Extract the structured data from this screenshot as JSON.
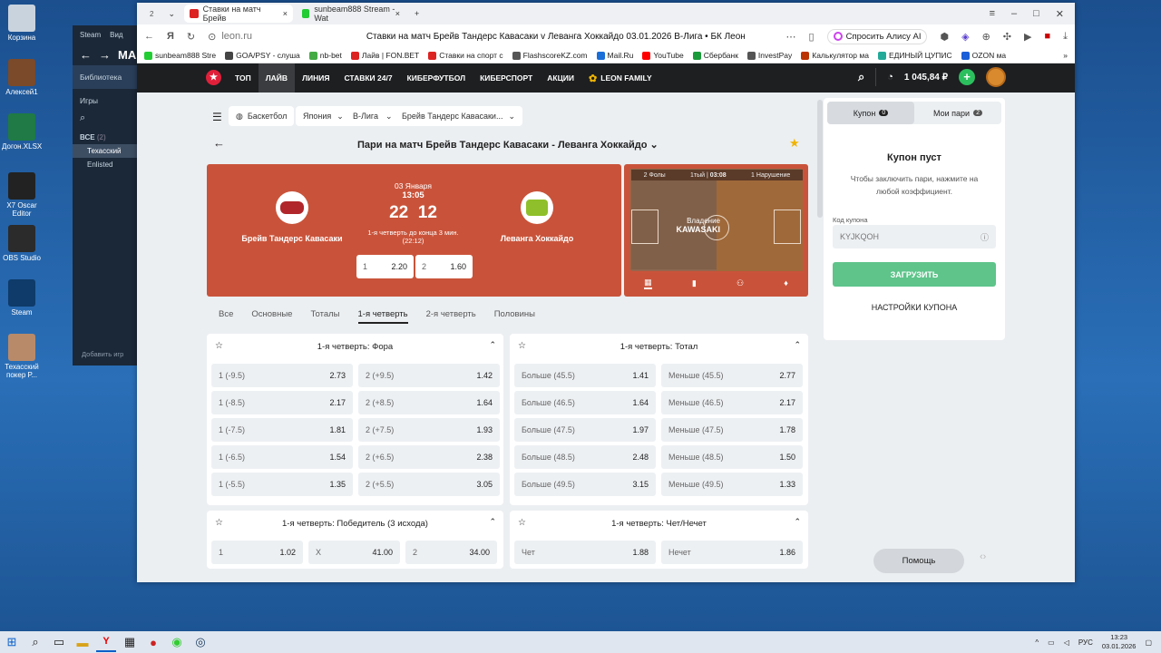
{
  "desktop": {
    "icons": [
      {
        "label": "Корзина",
        "color": "#c9d3de"
      },
      {
        "label": "Алексей1",
        "color": "#7a4a2a"
      },
      {
        "label": "Догон.XLSX",
        "color": "#1f7a45"
      },
      {
        "label": "X7 Oscar Editor",
        "color": "#222"
      },
      {
        "label": "OBS Studio",
        "color": "#2b2b2b"
      },
      {
        "label": "Steam",
        "color": "#0e3b6a"
      },
      {
        "label": "Техасский покер Р...",
        "color": "#b88a6a"
      }
    ]
  },
  "steam": {
    "top": [
      "Steam",
      "Вид"
    ],
    "title": "МАГ",
    "library": "Библиотека",
    "games": "Игры",
    "all": "ВСЕ",
    "all_count": "(2)",
    "items": [
      "Техасский",
      "Enlisted"
    ],
    "add": "Добавить игр"
  },
  "browser": {
    "tabs": [
      {
        "label": "Ставки на матч Брейв",
        "color": "#d22"
      },
      {
        "label": "sunbeam888 Stream - Wat",
        "color": "#2c3"
      }
    ],
    "tab_count": "2",
    "url": "leon.ru",
    "page_title": "Ставки на матч Брейв Тандерс Кавасаки v Леванга Хоккайдо 03.01.2026 В-Лига • БК Леон",
    "alice": "Спросить Алису AI",
    "bookmarks": [
      {
        "label": "sunbeam888 Stre",
        "color": "#2c3"
      },
      {
        "label": "GOA/PSY - слуша",
        "color": "#444"
      },
      {
        "label": "nb-bet",
        "color": "#4a4"
      },
      {
        "label": "Лайв | FON.BET",
        "color": "#d22"
      },
      {
        "label": "Ставки на спорт с",
        "color": "#d22"
      },
      {
        "label": "FlashscoreKZ.com",
        "color": "#555"
      },
      {
        "label": "Mail.Ru",
        "color": "#1a6ed8"
      },
      {
        "label": "YouTube",
        "color": "#f00"
      },
      {
        "label": "Сбербанк",
        "color": "#1a9a3a"
      },
      {
        "label": "InvestPay",
        "color": "#555"
      },
      {
        "label": "Калькулятор ма",
        "color": "#b30"
      },
      {
        "label": "ЕДИНЫЙ ЦУПИС",
        "color": "#2a9"
      },
      {
        "label": "OZON ма",
        "color": "#1a5ed8"
      }
    ]
  },
  "leon": {
    "nav": [
      "ТОП",
      "ЛАЙВ",
      "ЛИНИЯ",
      "СТАВКИ 24/7",
      "КИБЕРФУТБОЛ",
      "КИБЕРСПОРТ",
      "АКЦИИ",
      "LEON FAMILY"
    ],
    "balance": "1 045,84 ₽",
    "breadcrumbs": [
      "Баскетбол",
      "Япония",
      "В-Лига",
      "Брейв Тандерс Кавасаки..."
    ],
    "event_title": "Пари на матч Брейв Тандерс Кавасаки - Леванга Хоккайдо",
    "match": {
      "date": "03 Января",
      "time": "13:05",
      "home": "Брейв Тандерс Кавасаки",
      "away": "Леванга Хоккайдо",
      "score_home": "22",
      "score_away": "12",
      "period": "1-я четверть до конца 3 мин.",
      "period_score": "(22:12)",
      "odd1_label": "1",
      "odd1": "2.20",
      "odd2_label": "2",
      "odd2": "1.60"
    },
    "court": {
      "fouls": "2 Фолы",
      "period": "1тый",
      "clock": "03:08",
      "violations": "1 Нарушение",
      "possession_label": "Владение",
      "possession_team": "KAWASAKI"
    },
    "market_tabs": [
      "Все",
      "Основные",
      "Тоталы",
      "1-я четверть",
      "2-я четверть",
      "Половины"
    ],
    "markets": [
      {
        "title": "1-я четверть: Фора",
        "rows": [
          [
            "1 (-9.5)",
            "2.73",
            "2 (+9.5)",
            "1.42"
          ],
          [
            "1 (-8.5)",
            "2.17",
            "2 (+8.5)",
            "1.64"
          ],
          [
            "1 (-7.5)",
            "1.81",
            "2 (+7.5)",
            "1.93"
          ],
          [
            "1 (-6.5)",
            "1.54",
            "2 (+6.5)",
            "2.38"
          ],
          [
            "1 (-5.5)",
            "1.35",
            "2 (+5.5)",
            "3.05"
          ]
        ]
      },
      {
        "title": "1-я четверть: Тотал",
        "rows": [
          [
            "Больше (45.5)",
            "1.41",
            "Меньше (45.5)",
            "2.77"
          ],
          [
            "Больше (46.5)",
            "1.64",
            "Меньше (46.5)",
            "2.17"
          ],
          [
            "Больше (47.5)",
            "1.97",
            "Меньше (47.5)",
            "1.78"
          ],
          [
            "Больше (48.5)",
            "2.48",
            "Меньше (48.5)",
            "1.50"
          ],
          [
            "Больше (49.5)",
            "3.15",
            "Меньше (49.5)",
            "1.33"
          ]
        ]
      },
      {
        "title": "1-я четверть: Победитель (3 исхода)",
        "rows": [
          [
            "1",
            "1.02",
            "X",
            "41.00",
            "2",
            "34.00"
          ]
        ]
      },
      {
        "title": "1-я четверть: Чет/Нечет",
        "rows": [
          [
            "Чет",
            "1.88",
            "Нечет",
            "1.86"
          ]
        ]
      }
    ],
    "coupon": {
      "tab1": "Купон",
      "tab1_count": "0",
      "tab2": "Мои пари",
      "tab2_count": "2",
      "empty_title": "Купон пуст",
      "empty_text": "Чтобы заключить пари, нажмите на любой коэффициент.",
      "code_label": "Код купона",
      "code_placeholder": "KYJKQOH",
      "load": "ЗАГРУЗИТЬ",
      "settings": "НАСТРОЙКИ КУПОНА"
    },
    "help": "Помощь"
  },
  "taskbar": {
    "lang": "РУС",
    "time": "13:23",
    "date": "03.01.2026"
  }
}
